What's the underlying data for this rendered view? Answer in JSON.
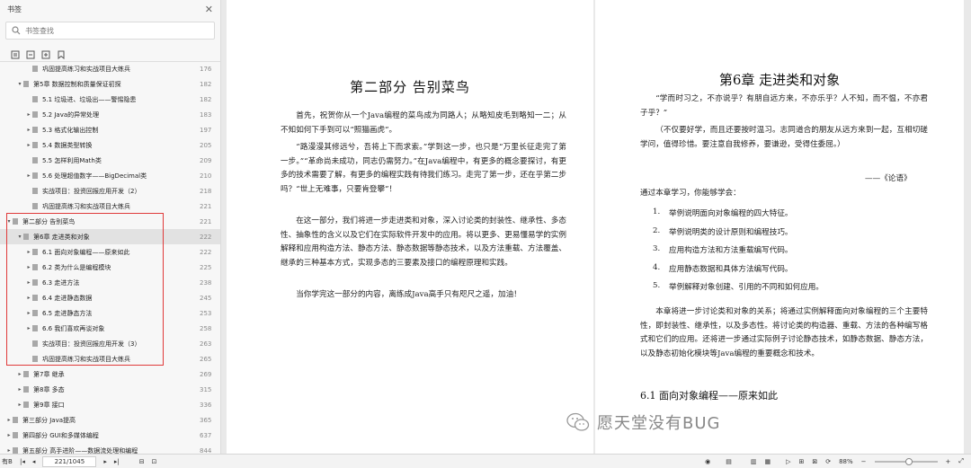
{
  "sidebar": {
    "title": "书签",
    "search_placeholder": "书签查找",
    "toc": [
      {
        "label": "巩固提高练习和实战项目大练兵",
        "page": "176",
        "level": 2,
        "arrow": ""
      },
      {
        "label": "第5章  数据控制和质量保证初探",
        "page": "182",
        "level": 1,
        "arrow": "▾"
      },
      {
        "label": "5.1  垃圾进、垃圾出——警惕隐患",
        "page": "182",
        "level": 2,
        "arrow": ""
      },
      {
        "label": "5.2  Java的异常处理",
        "page": "183",
        "level": 2,
        "arrow": "▸"
      },
      {
        "label": "5.3  格式化输出控制",
        "page": "197",
        "level": 2,
        "arrow": "▸"
      },
      {
        "label": "5.4  数据类型转换",
        "page": "205",
        "level": 2,
        "arrow": "▸"
      },
      {
        "label": "5.5  怎样利用Math类",
        "page": "209",
        "level": 2,
        "arrow": ""
      },
      {
        "label": "5.6  处理超值数字——BigDecimal类",
        "page": "210",
        "level": 2,
        "arrow": "▸"
      },
      {
        "label": "实战项目：投资回报应用开发（2）",
        "page": "218",
        "level": 2,
        "arrow": ""
      },
      {
        "label": "巩固提高练习和实战项目大练兵",
        "page": "221",
        "level": 2,
        "arrow": ""
      },
      {
        "label": "第二部分  告别菜鸟",
        "page": "221",
        "level": 0,
        "arrow": "▾"
      },
      {
        "label": "第6章  走进类和对象",
        "page": "222",
        "level": 1,
        "arrow": "▾",
        "selected": true
      },
      {
        "label": "6.1  面向对象编程——原来如此",
        "page": "222",
        "level": 2,
        "arrow": "▸"
      },
      {
        "label": "6.2  类为什么是编程模块",
        "page": "225",
        "level": 2,
        "arrow": "▸"
      },
      {
        "label": "6.3  走进方法",
        "page": "238",
        "level": 2,
        "arrow": "▸"
      },
      {
        "label": "6.4  走进静态数据",
        "page": "245",
        "level": 2,
        "arrow": "▸"
      },
      {
        "label": "6.5  走进静态方法",
        "page": "253",
        "level": 2,
        "arrow": "▸"
      },
      {
        "label": "6.6  我们喜欢再谈对象",
        "page": "258",
        "level": 2,
        "arrow": "▸"
      },
      {
        "label": "实战项目：投资回报应用开发（3）",
        "page": "263",
        "level": 2,
        "arrow": ""
      },
      {
        "label": "巩固提高练习和实战项目大练兵",
        "page": "265",
        "level": 2,
        "arrow": ""
      },
      {
        "label": "第7章  继承",
        "page": "269",
        "level": 1,
        "arrow": "▸"
      },
      {
        "label": "第8章  多态",
        "page": "315",
        "level": 1,
        "arrow": "▸"
      },
      {
        "label": "第9章  接口",
        "page": "336",
        "level": 1,
        "arrow": "▸"
      },
      {
        "label": "第三部分  Java提高",
        "page": "365",
        "level": 0,
        "arrow": "▸"
      },
      {
        "label": "第四部分  GUI和多媒体编程",
        "page": "637",
        "level": 0,
        "arrow": "▸"
      },
      {
        "label": "第五部分  高手进阶——数据流处理和编程",
        "page": "844",
        "level": 0,
        "arrow": "▸"
      }
    ]
  },
  "left_page": {
    "heading": "第二部分    告别菜鸟",
    "paragraphs": [
      "首先，祝贺你从一个Java编程的菜鸟成为同路人；从略知皮毛到略知一二；从不知如何下手到可以“照猫画虎”。",
      "“路漫漫其修远兮，吾将上下而求索。”学到这一步，也只是“万里长征走完了第一步。”“革命尚未成功，同志仍需努力。”在Java编程中，有更多的概念要探讨，有更多的技术需要了解，有更多的编程实践有待我们练习。走完了第一步，还在乎第二步吗？“世上无难事，只要肯登攀”！",
      "在这一部分，我们将进一步走进类和对象，深入讨论类的封装性、继承性、多态性、抽象性的含义以及它们在实际软件开发中的应用。将以更多、更易懂易学的实例解释和应用构造方法、静态方法、静态数据等静态技术，以及方法重载、方法覆盖、继承的三种基本方式，实现多态的三要素及接口的编程原理和实践。",
      "当你学完这一部分的内容，离练成Java高手只有咫尺之遥，加油！"
    ]
  },
  "right_page": {
    "chapter_title": "第6章    走进类和对象",
    "quote1": "“学而时习之，不亦说乎？有朋自远方来，不亦乐乎？人不知，而不愠，不亦君子乎？”",
    "quote2": "（不仅要好学，而且还要按时温习。志同道合的朋友从远方来到一起，互相切磋学问，值得珍惜。要注意自我修养，要谦逊，受得住委屈。）",
    "source": "——《论语》",
    "intro": "通过本章学习，你能够学会：",
    "objectives": [
      {
        "num": "1.",
        "text": "举例说明面向对象编程的四大特征。"
      },
      {
        "num": "2.",
        "text": "举例说明类的设计原则和编程技巧。"
      },
      {
        "num": "3.",
        "text": "应用构造方法和方法重载编写代码。"
      },
      {
        "num": "4.",
        "text": "应用静态数据和具体方法编写代码。"
      },
      {
        "num": "5.",
        "text": "举例解释对象创建、引用的不同和如何应用。"
      }
    ],
    "summary": "本章将进一步讨论类和对象的关系；将通过实例解释面向对象编程的三个主要特性，即封装性、继承性，以及多态性。将讨论类的构造器、重载、方法的各种编写格式和它们的应用。还将进一步通过实际例子讨论静态技术，如静态数据、静态方法，以及静态初始化模块等Java编程的重要概念和技术。",
    "section_heading": "6.1    面向对象编程——原来如此"
  },
  "watermark": "愿天堂没有BUG",
  "statusbar": {
    "page_indicator": "221/1045",
    "zoom": "88%",
    "left_label": "有B"
  }
}
